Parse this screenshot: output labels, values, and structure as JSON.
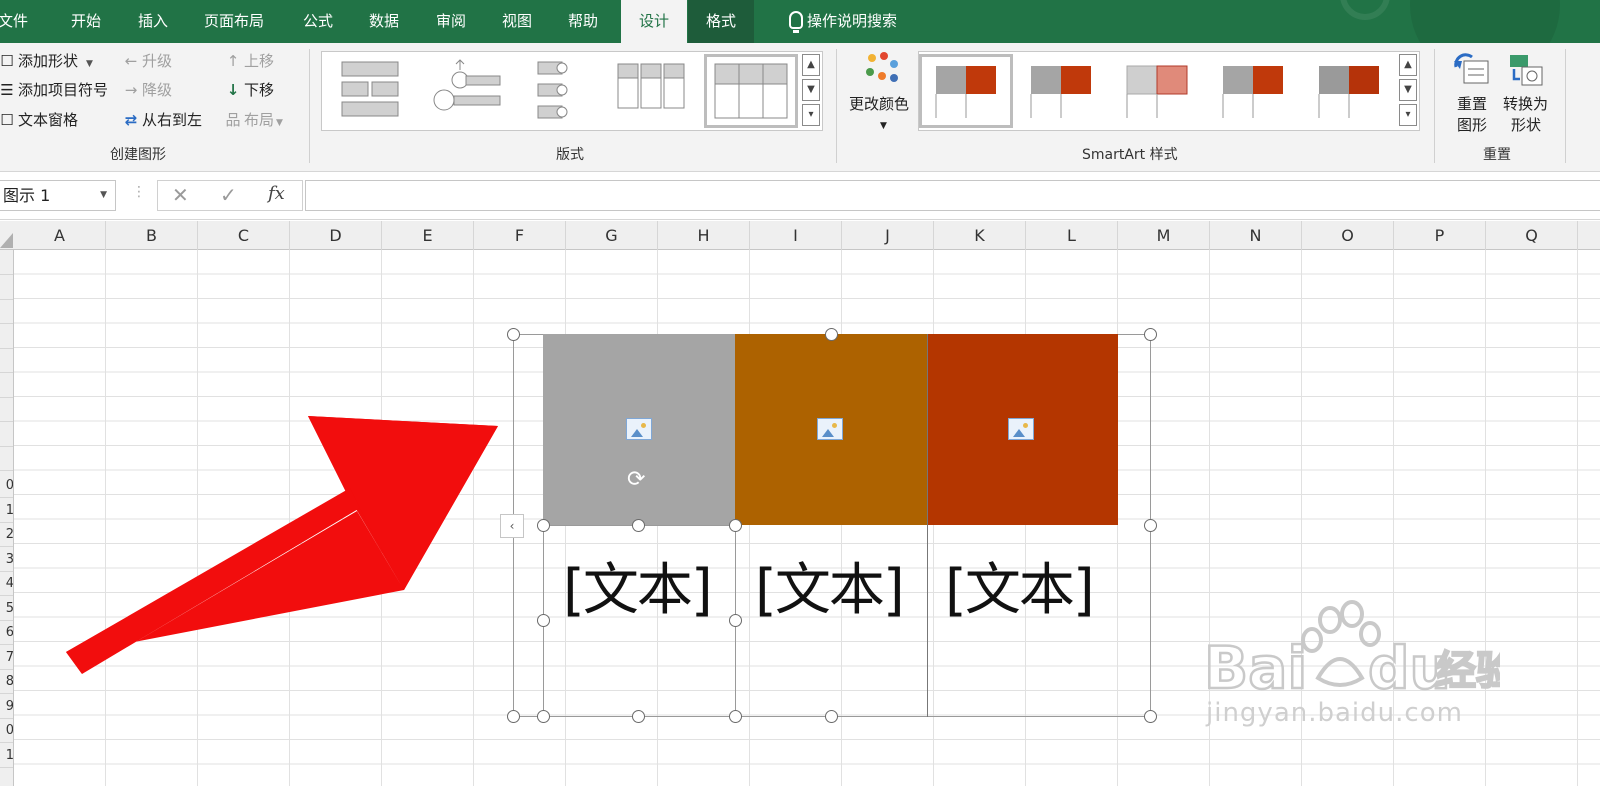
{
  "tabs": [
    "文件",
    "开始",
    "插入",
    "页面布局",
    "公式",
    "数据",
    "审阅",
    "视图",
    "帮助",
    "设计",
    "格式"
  ],
  "active_tab": "设计",
  "tell_me": "操作说明搜索",
  "create_graphic": {
    "add_shape": "添加形状",
    "add_bullet": "添加项目符号",
    "text_pane": "文本窗格",
    "promote": "升级",
    "demote": "降级",
    "right_to_left": "从右到左",
    "move_up": "上移",
    "move_down": "下移",
    "layout": "布局",
    "group_label": "创建图形"
  },
  "layouts": {
    "group_label": "版式"
  },
  "styles": {
    "change_colors": "更改颜色",
    "group_label": "SmartArt 样式"
  },
  "reset": {
    "reset_graphic_1": "重置",
    "reset_graphic_2": "图形",
    "convert_1": "转换为",
    "convert_2": "形状",
    "group_label": "重置"
  },
  "formula_bar": {
    "name_box": "图示 1",
    "fx": "fx"
  },
  "columns": [
    "A",
    "B",
    "C",
    "D",
    "E",
    "F",
    "G",
    "H",
    "I",
    "J",
    "K",
    "L",
    "M",
    "N",
    "O",
    "P",
    "Q"
  ],
  "rows": [
    "",
    "",
    "",
    "",
    "",
    "",
    "",
    "",
    "",
    "0",
    "1",
    "2",
    "3",
    "4",
    "5",
    "6",
    "7",
    "8",
    "9",
    "0",
    "1"
  ],
  "smartart": {
    "texts": [
      "[文本]",
      "[文本]",
      "[文本]"
    ],
    "colors": [
      "#a5a5a5",
      "#ad6200",
      "#b43600"
    ]
  },
  "colors": {
    "excel_green": "#217346",
    "arrow_red": "#f20d0d"
  },
  "watermark": {
    "brand": "Bai du 经验",
    "url": "jingyan.baidu.com"
  }
}
